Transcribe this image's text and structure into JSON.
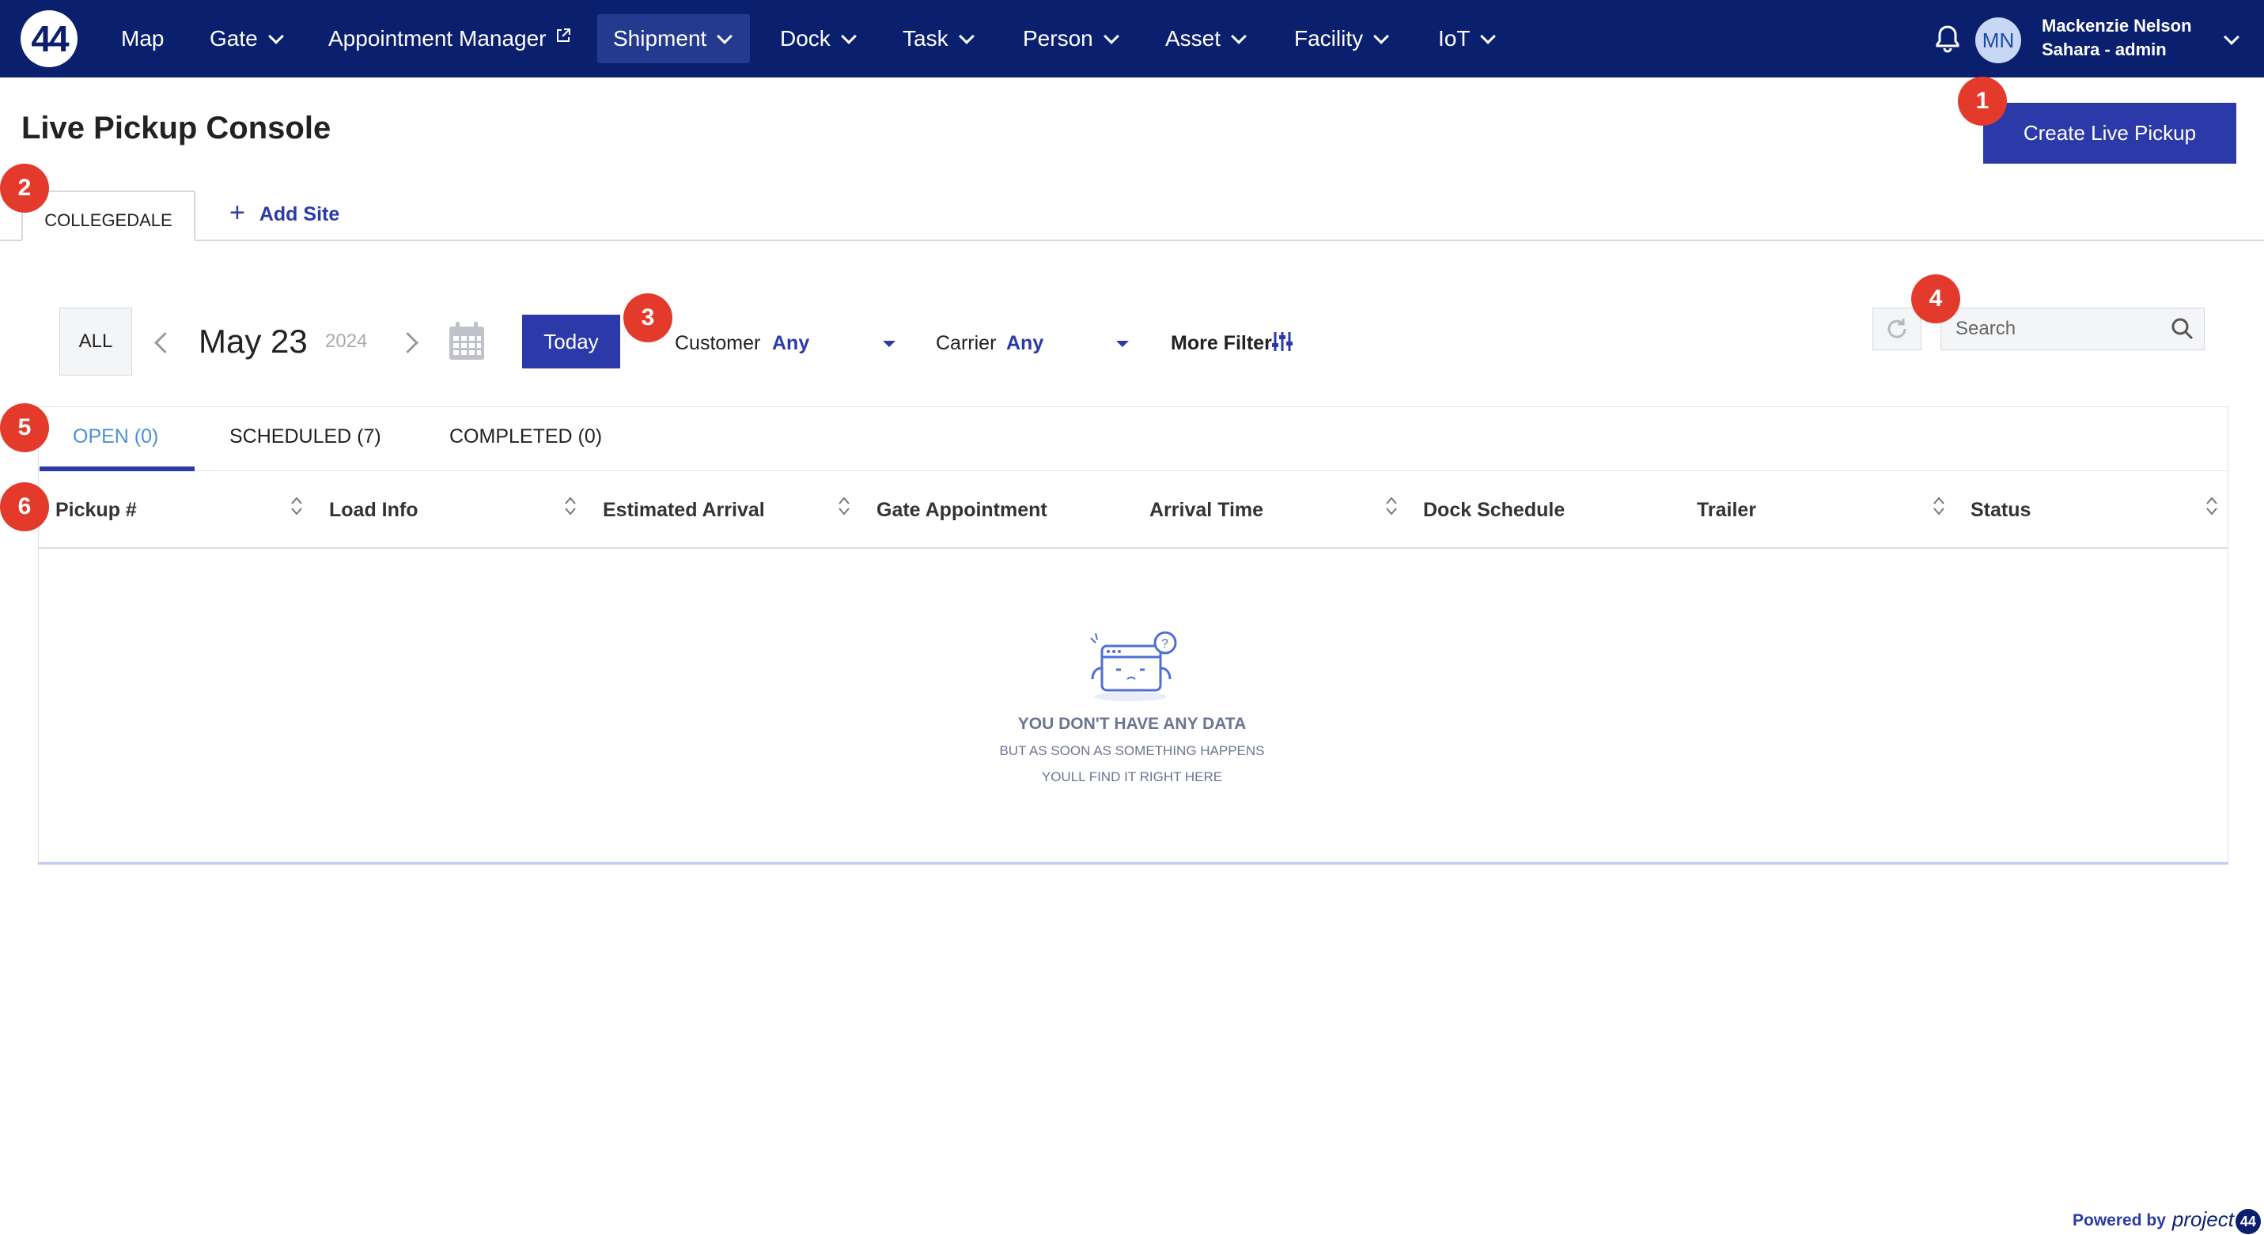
{
  "nav": {
    "logo_text": "44",
    "items": [
      {
        "label": "Map",
        "has_chevron": false
      },
      {
        "label": "Gate",
        "has_chevron": true
      },
      {
        "label": "Appointment Manager",
        "has_chevron": false,
        "external": true
      },
      {
        "label": "Shipment",
        "has_chevron": true,
        "active": true
      },
      {
        "label": "Dock",
        "has_chevron": true
      },
      {
        "label": "Task",
        "has_chevron": true
      },
      {
        "label": "Person",
        "has_chevron": true
      },
      {
        "label": "Asset",
        "has_chevron": true
      },
      {
        "label": "Facility",
        "has_chevron": true
      },
      {
        "label": "IoT",
        "has_chevron": true
      }
    ],
    "user": {
      "initials": "MN",
      "name": "Mackenzie Nelson",
      "role": "Sahara - admin"
    }
  },
  "header": {
    "title": "Live Pickup Console",
    "create_button": "Create Live Pickup"
  },
  "markers": [
    "1",
    "2",
    "3",
    "4",
    "5",
    "6"
  ],
  "sites": {
    "tabs": [
      "COLLEGEDALE"
    ],
    "add_label": "Add Site"
  },
  "filters": {
    "all_label": "ALL",
    "date": "May 23",
    "year": "2024",
    "today_label": "Today",
    "customer_label": "Customer",
    "customer_value": "Any",
    "carrier_label": "Carrier",
    "carrier_value": "Any",
    "more_filter_label": "More Filter",
    "search_placeholder": "Search"
  },
  "status_tabs": [
    {
      "label": "OPEN (0)",
      "active": true
    },
    {
      "label": "SCHEDULED (7)",
      "active": false
    },
    {
      "label": "COMPLETED (0)",
      "active": false
    }
  ],
  "table": {
    "columns": [
      {
        "label": "Pickup #",
        "sortable": true
      },
      {
        "label": "Load Info",
        "sortable": true
      },
      {
        "label": "Estimated Arrival",
        "sortable": true
      },
      {
        "label": "Gate Appointment",
        "sortable": false
      },
      {
        "label": "Arrival Time",
        "sortable": true
      },
      {
        "label": "Dock Schedule",
        "sortable": false
      },
      {
        "label": "Trailer",
        "sortable": true
      },
      {
        "label": "Status",
        "sortable": true
      }
    ],
    "rows": [],
    "empty": {
      "line1": "YOU DON'T HAVE ANY DATA",
      "line2": "BUT AS SOON AS SOMETHING HAPPENS",
      "line3": "YOULL FIND IT RIGHT HERE"
    }
  },
  "footer": {
    "powered_by": "Powered by",
    "brand": "project",
    "brand_num": "44"
  },
  "colors": {
    "nav_bg": "#0a1f6e",
    "primary": "#2b3aa8",
    "marker": "#e43a2c",
    "active_tab_text": "#4a8fd8"
  }
}
